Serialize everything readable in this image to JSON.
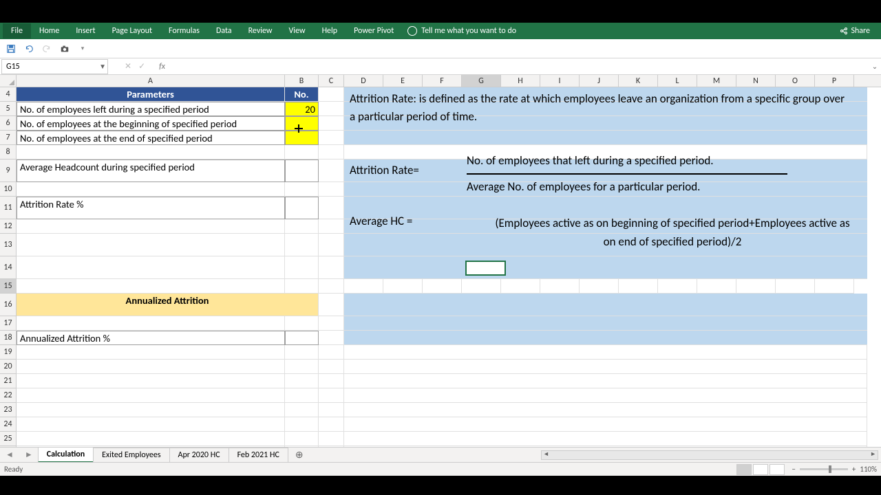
{
  "ribbon": {
    "file": "File",
    "tabs": [
      "Home",
      "Insert",
      "Page Layout",
      "Formulas",
      "Data",
      "Review",
      "View",
      "Help",
      "Power Pivot"
    ],
    "tell": "Tell me what you want to do",
    "share": "Share"
  },
  "namebox": "G15",
  "columns": [
    "A",
    "B",
    "C",
    "D",
    "E",
    "F",
    "G",
    "H",
    "I",
    "J",
    "K",
    "L",
    "M",
    "N",
    "O",
    "P"
  ],
  "sheet": {
    "paramHdr": "Parameters",
    "noHdr": "No.",
    "r5a": "No. of employees left during a specified period",
    "r5b": "20",
    "r6a": "No. of employees at the beginning of specified period",
    "r7a": "No. of employees at the end of specified period",
    "r9a": "Average Headcount during specified period",
    "r11a": "Attrition Rate %",
    "r16a": "Annualized Attrition",
    "r18a": "Annualized Attrition %"
  },
  "def": "Attrition Rate: is defined as the rate at which employees leave an organization from a specific group over a particular period of time.",
  "formula": {
    "rateLabel": "Attrition Rate=",
    "numerator": "No. of employees that left during a specified period.",
    "denominator": "Average No. of employees for a particular period.",
    "hcLabel": "Average HC =",
    "hcValue": "(Employees active as on beginning of specified period+Employees active as on end of specified period)/2"
  },
  "tabs": [
    "Calculation",
    "Exited Employees",
    "Apr 2020 HC",
    "Feb 2021 HC"
  ],
  "status": {
    "ready": "Ready",
    "zoom": "110%"
  }
}
